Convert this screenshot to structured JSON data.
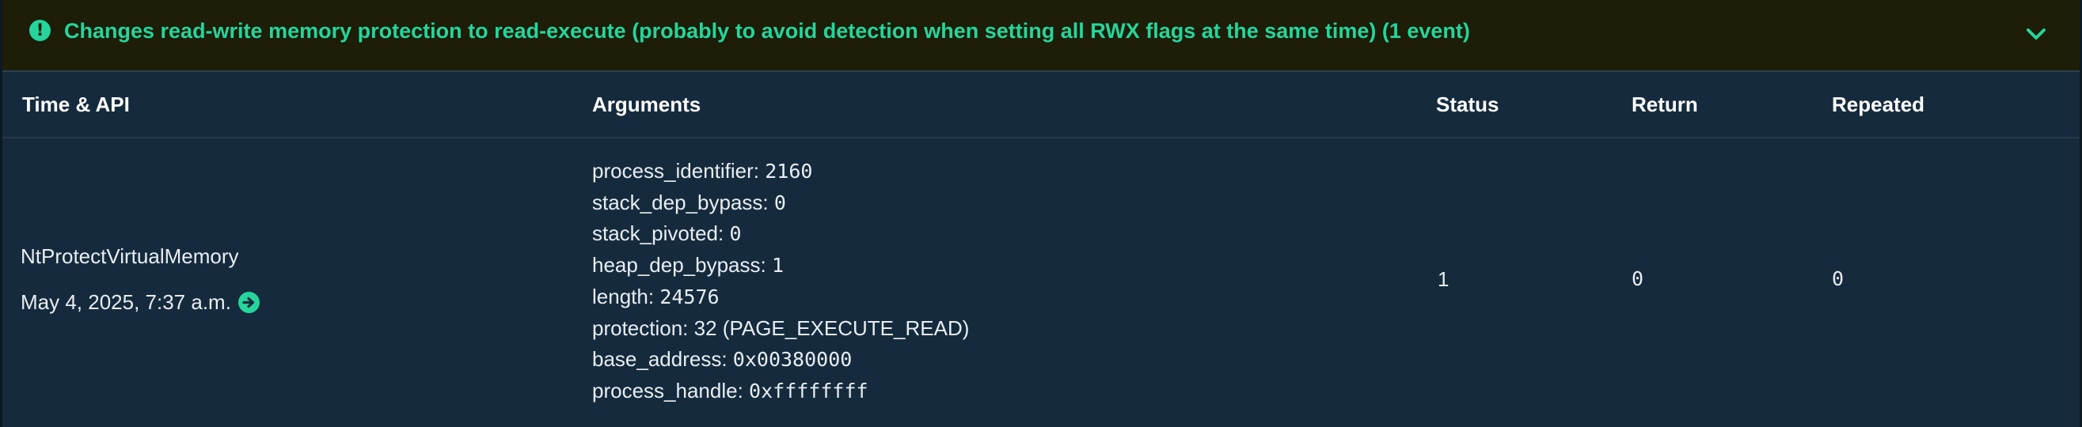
{
  "banner": {
    "icon": "exclamation-circle-icon",
    "title": "Changes read-write memory protection to read-execute (probably to avoid detection when setting all RWX flags at the same time) (1 event)",
    "toggle_icon": "chevron-down-icon",
    "accent_color": "#25d59c",
    "background_color": "#1d1d08"
  },
  "table": {
    "headers": {
      "time_api": "Time & API",
      "arguments": "Arguments",
      "status": "Status",
      "return": "Return",
      "repeated": "Repeated"
    },
    "row": {
      "api": "NtProtectVirtualMemory",
      "time": "May 4, 2025, 7:37 a.m.",
      "time_link_icon": "arrow-circle-right-icon",
      "arguments": [
        {
          "key": "process_identifier:",
          "value": "2160"
        },
        {
          "key": "stack_dep_bypass:",
          "value": "0"
        },
        {
          "key": "stack_pivoted:",
          "value": "0"
        },
        {
          "key": "heap_dep_bypass:",
          "value": "1"
        },
        {
          "key": "length:",
          "value": "24576"
        },
        {
          "key": "protection:",
          "value": "32 (PAGE_EXECUTE_READ)"
        },
        {
          "key": "base_address:",
          "value": "0x00380000"
        },
        {
          "key": "process_handle:",
          "value": "0xffffffff"
        }
      ],
      "status": "1",
      "return": "0",
      "repeated": "0"
    }
  }
}
